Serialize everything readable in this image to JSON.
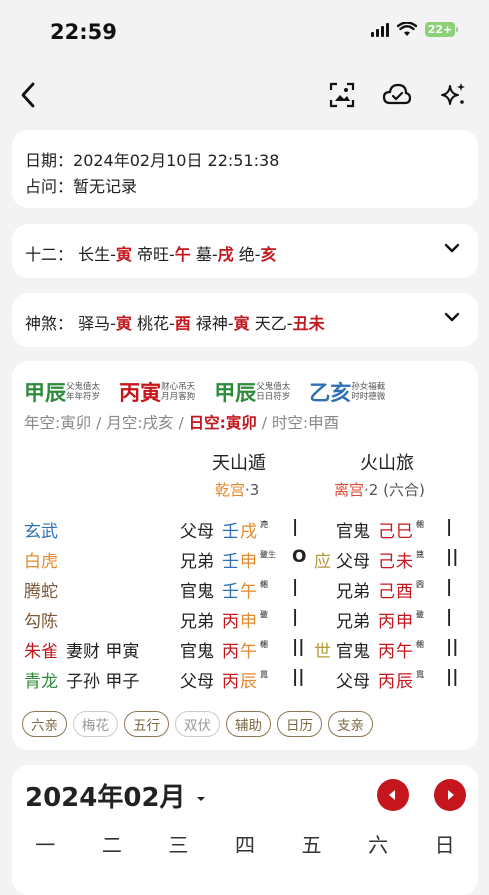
{
  "status": {
    "time": "22:59",
    "battery": "22+"
  },
  "info": {
    "date_label": "日期：",
    "date_value": "2024年02月10日 22:51:38",
    "ask_label": "占问：",
    "ask_value": "暂无记录"
  },
  "twelve": {
    "label": "十二：",
    "items": [
      {
        "name": "长生-",
        "branch": "寅"
      },
      {
        "name": "帝旺-",
        "branch": "午"
      },
      {
        "name": "墓-",
        "branch": "戌"
      },
      {
        "name": "绝-",
        "branch": "亥"
      }
    ]
  },
  "shensha": {
    "label": "神煞：",
    "items": [
      {
        "name": "驿马-",
        "branch": "寅"
      },
      {
        "name": "桃花-",
        "branch": "酉"
      },
      {
        "name": "禄神-",
        "branch": "寅"
      },
      {
        "name": "天乙-",
        "branch": "丑未"
      }
    ]
  },
  "pillars": [
    {
      "text": "甲辰",
      "color": "green",
      "gods": [
        "父鬼值太",
        "年年符岁"
      ]
    },
    {
      "text": "丙寅",
      "color": "red",
      "gods": [
        "财心吊天",
        "月月客狗"
      ]
    },
    {
      "text": "甲辰",
      "color": "green",
      "gods": [
        "父鬼值太",
        "日日符岁"
      ]
    },
    {
      "text": "乙亥",
      "color": "blue",
      "gods": [
        "孙女福截",
        "时时德微"
      ]
    }
  ],
  "kong": {
    "year": "年空:寅卯",
    "sep": " / ",
    "month": "月空:戌亥",
    "day": "日空:寅卯",
    "hour": "时空:申酉"
  },
  "hexagrams": {
    "main": {
      "name": "天山遁",
      "palace": "乾宫",
      "num": "·3"
    },
    "changed": {
      "name": "火山旅",
      "palace": "离宫",
      "num": "·2 (六合)"
    }
  },
  "lines": [
    {
      "god": "玄武",
      "god_color": "#2f6fb3",
      "hidden": "",
      "l_rel": "父母",
      "l_stem": "壬",
      "l_branch": "戌",
      "l_stem_c": "#2f6fb3",
      "l_mini": [
        "冲",
        "克"
      ],
      "l_yao": "|",
      "mark": "",
      "r_rel": "官鬼",
      "r_stem": "己",
      "r_branch": "巳",
      "r_stem_c": "#c4161c",
      "r_mini": [
        "休",
        "相"
      ],
      "r_yao": "|"
    },
    {
      "god": "白虎",
      "god_color": "#e5892b",
      "hidden": "",
      "l_rel": "兄弟",
      "l_stem": "壬",
      "l_branch": "申",
      "l_stem_c": "#2f6fb3",
      "l_mini": [
        "生",
        "破生"
      ],
      "l_yao": "O",
      "mark": "应",
      "r_rel": "父母",
      "r_stem": "己",
      "r_branch": "未",
      "r_stem_c": "#c4161c",
      "r_mini": [
        "扶",
        "克"
      ],
      "r_yao": "||"
    },
    {
      "god": "腾蛇",
      "god_color": "#7a5a3a",
      "hidden": "",
      "l_rel": "官鬼",
      "l_stem": "壬",
      "l_branch": "午",
      "l_stem_c": "#2f6fb3",
      "l_mini": [
        "休",
        "相"
      ],
      "l_yao": "|",
      "mark": "",
      "r_rel": "兄弟",
      "r_stem": "己",
      "r_branch": "酉",
      "r_stem_c": "#c4161c",
      "r_mini": [
        "合",
        "囚"
      ],
      "r_yao": "|"
    },
    {
      "god": "勾陈",
      "god_color": "#7a5a3a",
      "hidden": "",
      "l_rel": "兄弟",
      "l_stem": "丙",
      "l_branch": "申",
      "l_stem_c": "#c4161c",
      "l_mini": [
        "生",
        "破"
      ],
      "l_yao": "|",
      "mark": "",
      "r_rel": "兄弟",
      "r_stem": "丙",
      "r_branch": "申",
      "r_stem_c": "#c4161c",
      "r_mini": [
        "生",
        "破"
      ],
      "r_yao": "|"
    },
    {
      "god": "朱雀",
      "god_color": "#c4161c",
      "hidden": "妻财 甲寅",
      "l_rel": "官鬼",
      "l_stem": "丙",
      "l_branch": "午",
      "l_stem_c": "#c4161c",
      "l_mini": [
        "休",
        "相"
      ],
      "l_yao": "||",
      "mark": "世",
      "r_rel": "官鬼",
      "r_stem": "丙",
      "r_branch": "午",
      "r_stem_c": "#c4161c",
      "r_mini": [
        "休",
        "相"
      ],
      "r_yao": "||"
    },
    {
      "god": "青龙",
      "god_color": "#2e8b3b",
      "hidden": "子孙 甲子",
      "l_rel": "父母",
      "l_stem": "丙",
      "l_branch": "辰",
      "l_stem_c": "#c4161c",
      "l_mini": [
        "日",
        "克"
      ],
      "l_yao": "||",
      "mark": "",
      "r_rel": "父母",
      "r_stem": "丙",
      "r_branch": "辰",
      "r_stem_c": "#c4161c",
      "r_mini": [
        "日",
        "克"
      ],
      "r_yao": "||"
    }
  ],
  "chips": [
    {
      "label": "六亲",
      "active": true
    },
    {
      "label": "梅花",
      "active": false
    },
    {
      "label": "五行",
      "active": true
    },
    {
      "label": "双伏",
      "active": false
    },
    {
      "label": "辅助",
      "active": true
    },
    {
      "label": "日历",
      "active": true
    },
    {
      "label": "支亲",
      "active": true
    }
  ],
  "calendar": {
    "title": "2024年02月",
    "weekdays": [
      "一",
      "二",
      "三",
      "四",
      "五",
      "六",
      "日"
    ]
  }
}
